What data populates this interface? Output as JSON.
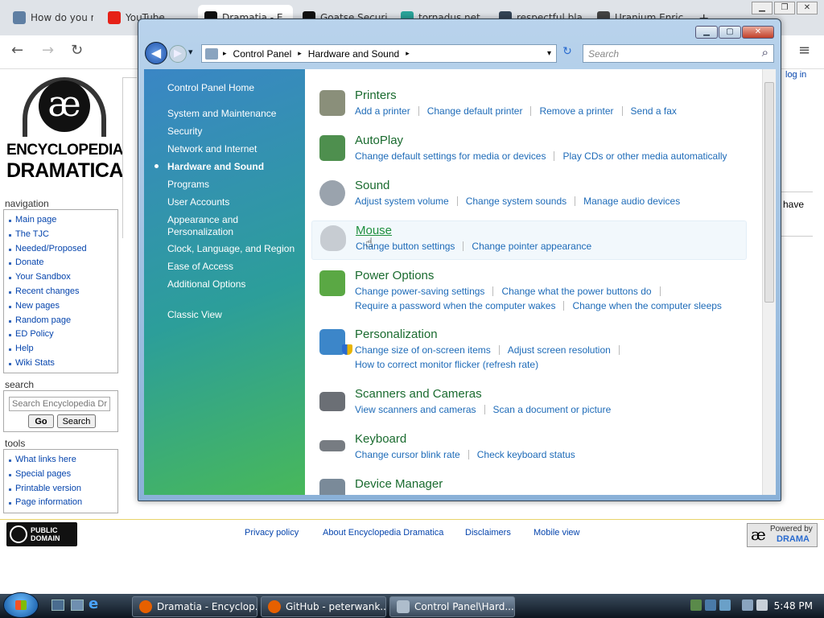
{
  "browser": {
    "tabs": [
      {
        "label": "How do you m",
        "color": "#5f7fa3"
      },
      {
        "label": "YouTube",
        "color": "#e62117"
      },
      {
        "label": "Dramatia - E",
        "color": "#111111"
      },
      {
        "label": "Goatse Securi",
        "color": "#111111"
      },
      {
        "label": "tornadus.net",
        "color": "#29a39a"
      },
      {
        "label": "respectful bla",
        "color": "#334455"
      },
      {
        "label": "Uranium Enric",
        "color": "#444444"
      }
    ],
    "new_tab": "+",
    "back": "←",
    "forward": "→",
    "reload": "↻",
    "menu": "≡",
    "win_min": "▁",
    "win_max": "❐",
    "win_close": "✕"
  },
  "wiki": {
    "logo_glyph": "æ",
    "logo_line1": "ENCYCLOPEDIA",
    "logo_line2": "DRAMATICA",
    "login": "log in",
    "right_fragment": "have",
    "navigation_title": "navigation",
    "navigation": [
      "Main page",
      "The TJC",
      "Needed/Proposed",
      "Donate",
      "Your Sandbox",
      "Recent changes",
      "New pages",
      "Random page",
      "ED Policy",
      "Help",
      "Wiki Stats"
    ],
    "search_title": "search",
    "search_placeholder": "Search Encyclopedia Dra",
    "go_label": "Go",
    "search_label": "Search",
    "tools_title": "tools",
    "tools": [
      "What links here",
      "Special pages",
      "Printable version",
      "Page information"
    ],
    "public_domain": "PUBLIC DOMAIN",
    "footer_links": [
      "Privacy policy",
      "About Encyclopedia Dramatica",
      "Disclaimers",
      "Mobile view"
    ],
    "powered_by": "Powered by",
    "powered_drama": "DRAMA"
  },
  "control_panel": {
    "win_min": "▁",
    "win_max": "▢",
    "win_close": "✕",
    "back": "◀",
    "forward": "▶",
    "dropdown": "▾",
    "breadcrumb": [
      "Control Panel",
      "Hardware and Sound"
    ],
    "crumb_sep": "▸",
    "refresh": "↻",
    "search_placeholder": "Search",
    "search_icon": "⌕",
    "side_home": "Control Panel Home",
    "side_links": [
      {
        "label": "System and Maintenance"
      },
      {
        "label": "Security"
      },
      {
        "label": "Network and Internet"
      },
      {
        "label": "Hardware and Sound",
        "current": true
      },
      {
        "label": "Programs"
      },
      {
        "label": "User Accounts"
      },
      {
        "label": "Appearance and Personalization"
      },
      {
        "label": "Clock, Language, and Region"
      },
      {
        "label": "Ease of Access"
      },
      {
        "label": "Additional Options"
      }
    ],
    "classic_view": "Classic View",
    "categories": [
      {
        "title": "Printers",
        "icon_color": "#8a8f7a",
        "links": [
          [
            "Add a printer",
            "Change default printer",
            "Remove a printer",
            "Send a fax"
          ]
        ]
      },
      {
        "title": "AutoPlay",
        "icon_color": "#4e8f4e",
        "links": [
          [
            "Change default settings for media or devices",
            "Play CDs or other media automatically"
          ]
        ]
      },
      {
        "title": "Sound",
        "icon_color": "#9aa3ad",
        "links": [
          [
            "Adjust system volume",
            "Change system sounds",
            "Manage audio devices"
          ]
        ]
      },
      {
        "title": "Mouse",
        "icon_color": "#c7ccd2",
        "links": [
          [
            "Change button settings",
            "Change pointer appearance"
          ]
        ]
      },
      {
        "title": "Power Options",
        "icon_color": "#5aa844",
        "links": [
          [
            "Change power-saving settings",
            "Change what the power buttons do"
          ],
          [
            "Require a password when the computer wakes",
            "Change when the computer sleeps"
          ]
        ]
      },
      {
        "title": "Personalization",
        "icon_color": "#3c86c9",
        "links": [
          [
            "Change size of on-screen items",
            "Adjust screen resolution"
          ],
          [
            "How to correct monitor flicker (refresh rate)"
          ]
        ]
      },
      {
        "title": "Scanners and Cameras",
        "icon_color": "#6b6f75",
        "links": [
          [
            "View scanners and cameras",
            "Scan a document or picture"
          ]
        ]
      },
      {
        "title": "Keyboard",
        "icon_color": "#777c82",
        "links": [
          [
            "Change cursor blink rate",
            "Check keyboard status"
          ]
        ]
      },
      {
        "title": "Device Manager",
        "icon_color": "#7a8a99",
        "links": []
      }
    ]
  },
  "taskbar": {
    "items": [
      {
        "label": "Dramatia - Encyclop...",
        "active": false
      },
      {
        "label": "GitHub - peterwank...",
        "active": false
      },
      {
        "label": "Control Panel\\Hard...",
        "active": true
      }
    ],
    "clock": "5:48 PM",
    "ie_glyph": "e"
  }
}
